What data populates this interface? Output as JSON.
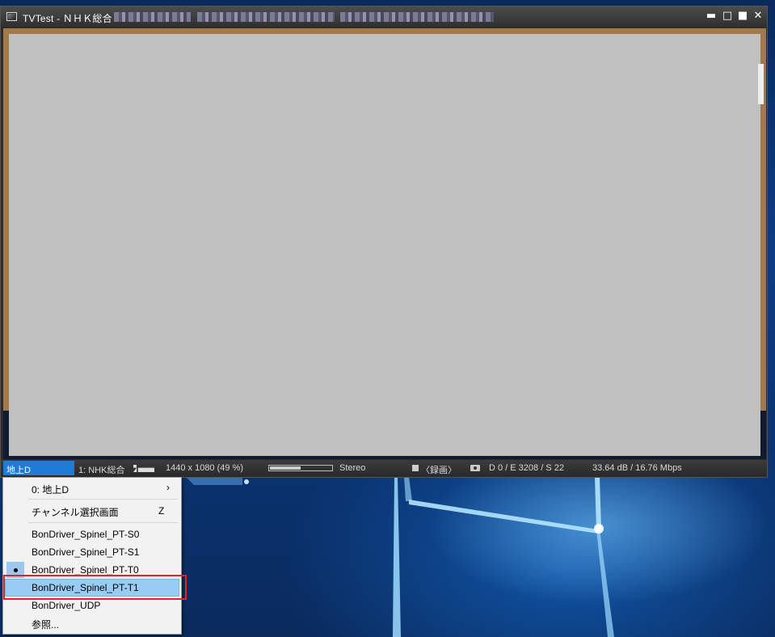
{
  "window": {
    "title": "TVTest - ＮＨＫ総合"
  },
  "statusbar": {
    "tuner_space": "地上D",
    "channel": "1: NHK総合",
    "video_size": "1440 x 1080 (49 %)",
    "volume_level": 0.5,
    "audio": "Stereo",
    "record": "〈録画〉",
    "error_stats": "D 0 / E 3208 / S 22",
    "signal": "33.64 dB / 16.76 Mbps"
  },
  "menu": {
    "items": [
      {
        "label": "0: 地上D",
        "submenu": true
      },
      {
        "label": "チャンネル選択画面",
        "accel": "Z"
      },
      {
        "label": "BonDriver_Spinel_PT-S0"
      },
      {
        "label": "BonDriver_Spinel_PT-S1"
      },
      {
        "label": "BonDriver_Spinel_PT-T0",
        "checked": true
      },
      {
        "label": "BonDriver_Spinel_PT-T1",
        "highlighted": true
      },
      {
        "label": "BonDriver_UDP"
      },
      {
        "label": "参照..."
      }
    ]
  },
  "colors": {
    "accent": "#1e7bd8",
    "highlight": "#99ccf5",
    "annotation": "#e0242a"
  }
}
